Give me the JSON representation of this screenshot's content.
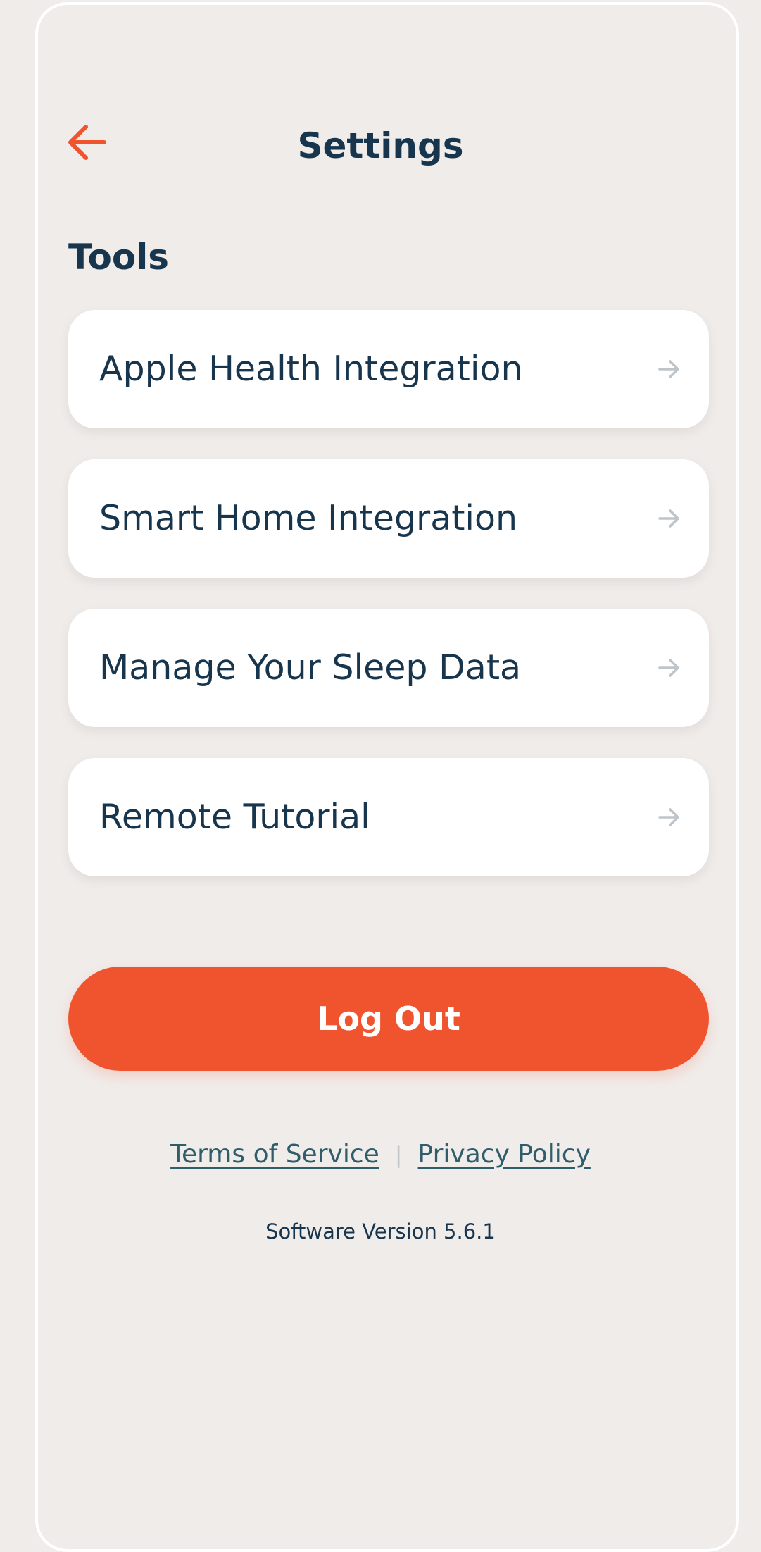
{
  "header": {
    "title": "Settings",
    "back_icon": "arrow-left-icon",
    "accent_color": "#f0542f"
  },
  "tools": {
    "heading": "Tools",
    "items": [
      {
        "label": "Apple Health Integration",
        "icon": "arrow-right-icon"
      },
      {
        "label": "Smart Home Integration",
        "icon": "arrow-right-icon"
      },
      {
        "label": "Manage Your Sleep Data",
        "icon": "arrow-right-icon"
      },
      {
        "label": "Remote Tutorial",
        "icon": "arrow-right-icon"
      }
    ]
  },
  "logout": {
    "label": "Log Out",
    "color": "#f0542f"
  },
  "footer": {
    "terms_label": "Terms of Service",
    "separator": "|",
    "privacy_label": "Privacy Policy",
    "version": "Software Version 5.6.1"
  }
}
